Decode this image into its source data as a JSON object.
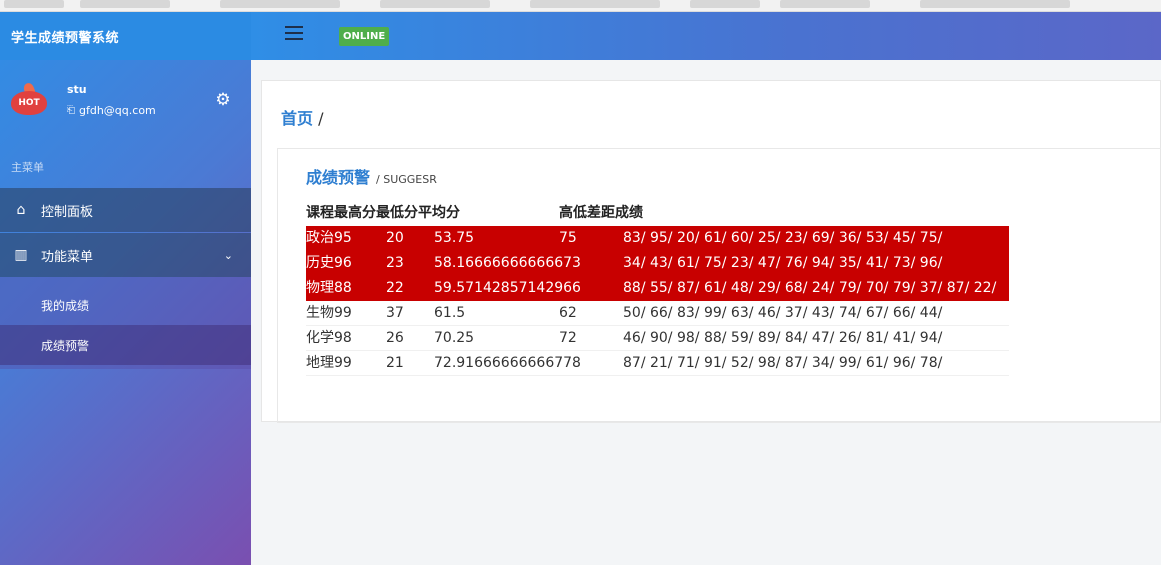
{
  "app": {
    "title": "学生成绩预警系统",
    "status": "ONLINE"
  },
  "user": {
    "name": "stu",
    "email": "gfdh@qq.com",
    "avatar_text": "HOT"
  },
  "sidebar": {
    "menu_label": "主菜单",
    "dashboard": "控制面板",
    "function_menu": "功能菜单",
    "sub_items": [
      "我的成绩",
      "成绩预警"
    ]
  },
  "breadcrumb": {
    "home": "首页",
    "sep": "/"
  },
  "section": {
    "title": "成绩预警",
    "subtitle": "/ SUGGESR"
  },
  "table": {
    "headers": [
      "课程最高分",
      "最低分",
      "平均分",
      "",
      "高低差距",
      "成绩"
    ],
    "header_text": "课程最高分最低分平均分",
    "header_text2": "高低差距成绩",
    "rows": [
      {
        "course": "政治95",
        "min": "20",
        "avg": "53.75",
        "diff": "75",
        "scores": "83/ 95/ 20/ 61/ 60/ 25/ 23/ 69/ 36/ 53/ 45/ 75/",
        "warn": true
      },
      {
        "course": "历史96",
        "min": "23",
        "avg": "58.16666666666673",
        "diff": "",
        "scores": "34/ 43/ 61/ 75/ 23/ 47/ 76/ 94/ 35/ 41/ 73/ 96/",
        "warn": true
      },
      {
        "course": "物理88",
        "min": "22",
        "avg": "59.57142857142966",
        "diff": "",
        "scores": "88/ 55/ 87/ 61/ 48/ 29/ 68/ 24/ 79/ 70/ 79/ 37/ 87/ 22/",
        "warn": true
      },
      {
        "course": "生物99",
        "min": "37",
        "avg": "61.5",
        "diff": "62",
        "scores": "50/ 66/ 83/ 99/ 63/ 46/ 37/ 43/ 74/ 67/ 66/ 44/",
        "warn": false
      },
      {
        "course": "化学98",
        "min": "26",
        "avg": "70.25",
        "diff": "72",
        "scores": "46/ 90/ 98/ 88/ 59/ 89/ 84/ 47/ 26/ 81/ 41/ 94/",
        "warn": false
      },
      {
        "course": "地理99",
        "min": "21",
        "avg": "72.91666666666778",
        "diff": "",
        "scores": "87/ 21/ 71/ 91/ 52/ 98/ 87/ 34/ 99/ 61/ 96/ 78/",
        "warn": false
      }
    ]
  },
  "colors": {
    "warn_row": "#c80000",
    "accent": "#2f7fd1",
    "status_green": "#4fae4b"
  }
}
